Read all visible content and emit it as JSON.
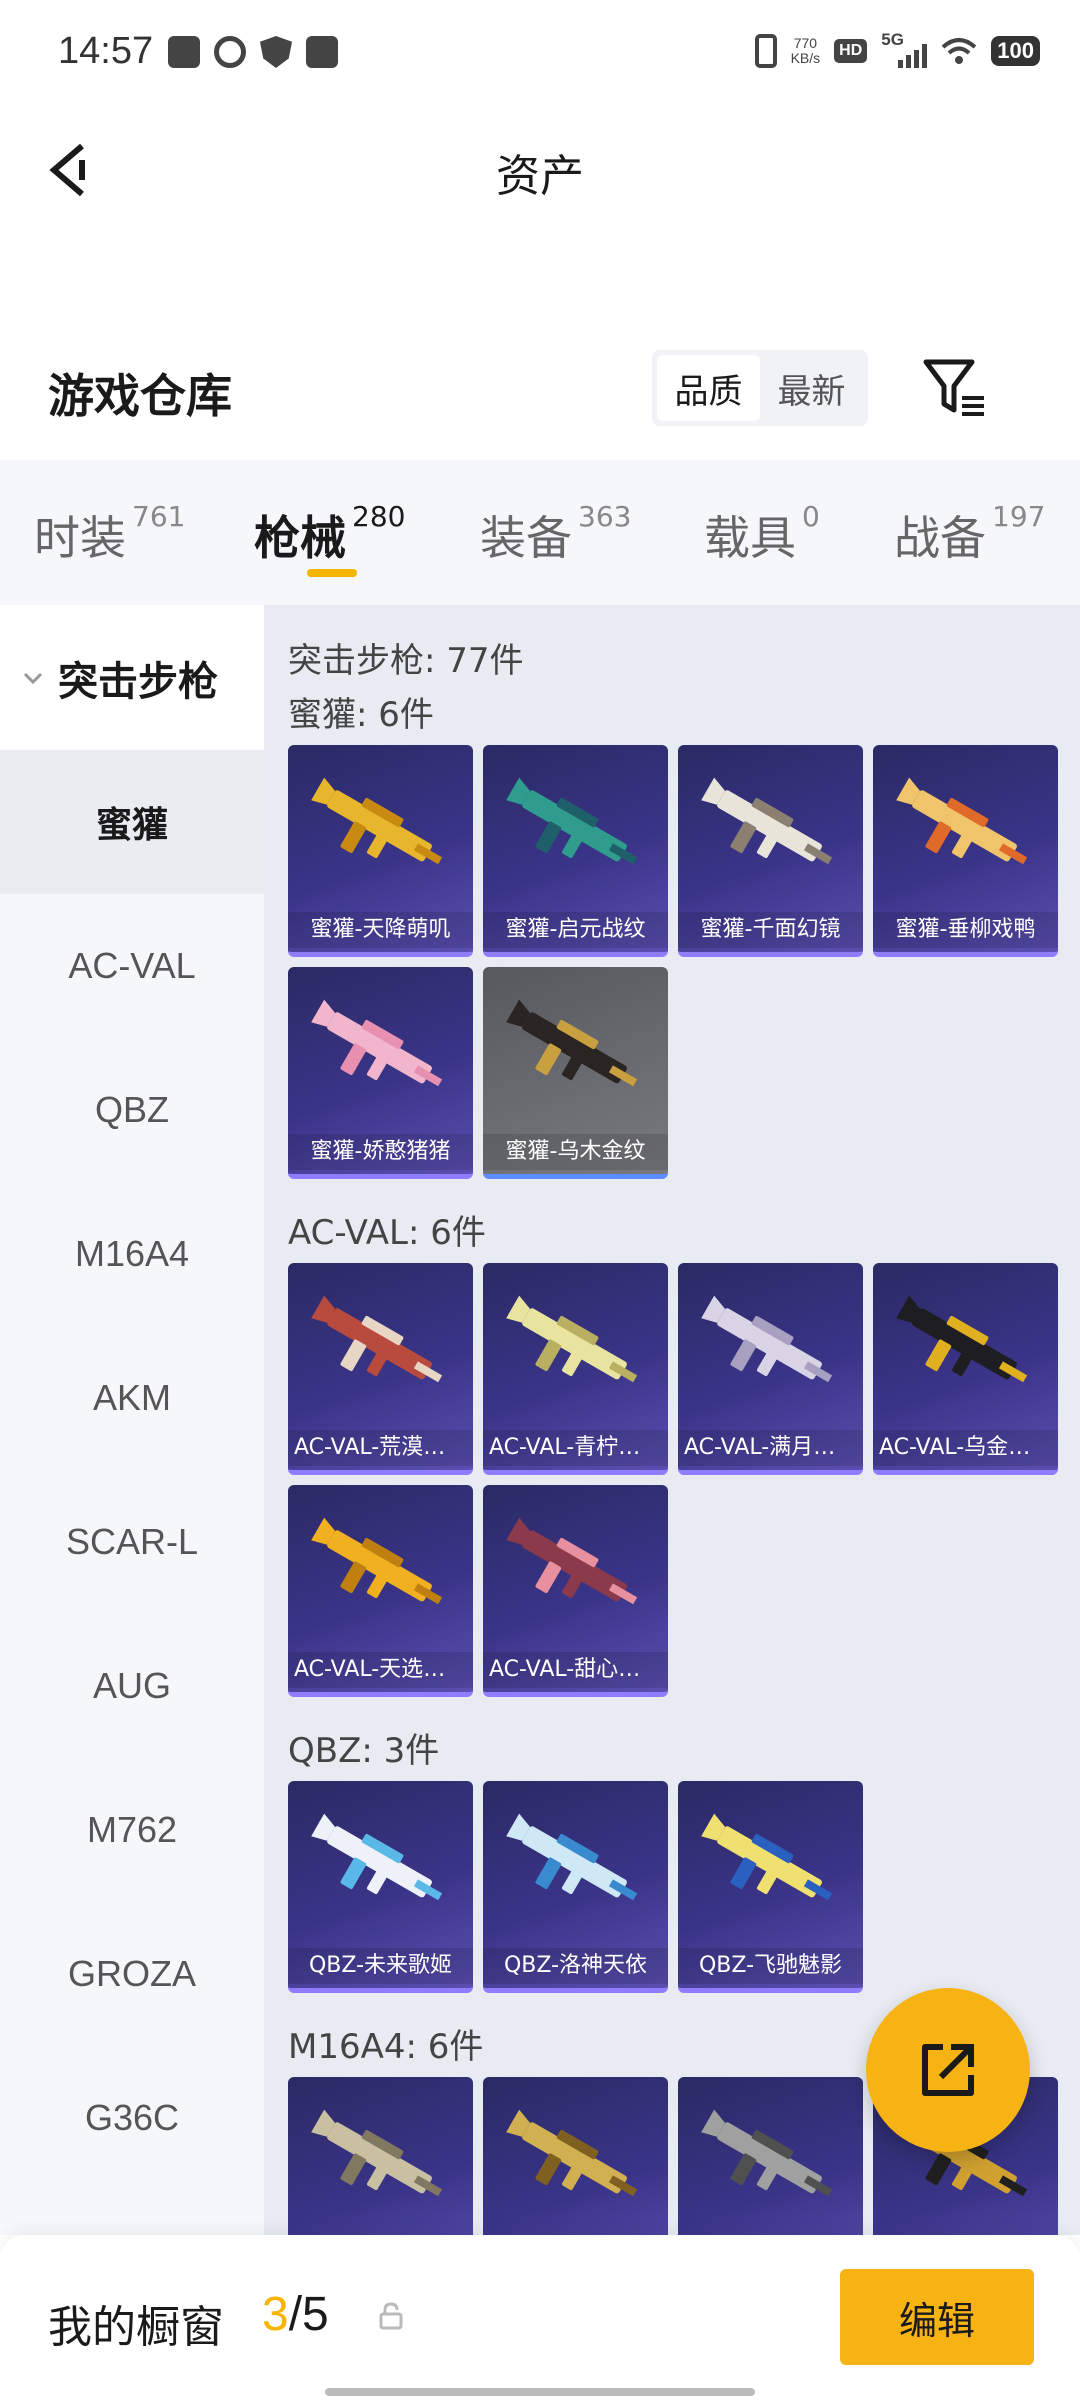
{
  "status_bar": {
    "time": "14:57",
    "net_speed_value": "770",
    "net_speed_unit": "KB/s",
    "hd": "HD",
    "network": "5G",
    "battery": "100"
  },
  "header": {
    "title": "资产"
  },
  "warehouse": {
    "title": "游戏仓库",
    "sort_options": [
      "品质",
      "最新"
    ],
    "sort_selected": "品质"
  },
  "category_tabs": [
    {
      "label": "时装",
      "count": "761"
    },
    {
      "label": "枪械",
      "count": "280"
    },
    {
      "label": "装备",
      "count": "363"
    },
    {
      "label": "载具",
      "count": "0"
    },
    {
      "label": "战备",
      "count": "197"
    }
  ],
  "active_tab": "枪械",
  "sidebar": {
    "header": "突击步枪",
    "items": [
      "蜜獾",
      "AC-VAL",
      "QBZ",
      "M16A4",
      "AKM",
      "SCAR-L",
      "AUG",
      "M762",
      "GROZA",
      "G36C"
    ],
    "active_item": "蜜獾"
  },
  "content": {
    "total": "突击步枪: 77件",
    "groups": [
      {
        "title": "蜜獾: 6件",
        "items": [
          {
            "name": "蜜獾-天降萌叽",
            "color": "#e8b62c",
            "accent": "#c98a12"
          },
          {
            "name": "蜜獾-启元战纹",
            "color": "#2f9c8e",
            "accent": "#1f5f6a"
          },
          {
            "name": "蜜獾-千面幻镜",
            "color": "#e9e4da",
            "accent": "#8a7f70"
          },
          {
            "name": "蜜獾-垂柳戏鸭",
            "color": "#f0c46a",
            "accent": "#e06a2a"
          },
          {
            "name": "蜜獾-娇憨猪猪",
            "color": "#f2b6cc",
            "accent": "#e890b0"
          },
          {
            "name": "蜜獾-乌木金纹",
            "color": "#2a2522",
            "accent": "#c9a040",
            "gray": true
          }
        ]
      },
      {
        "title": "AC-VAL: 6件",
        "items": [
          {
            "name": "AC-VAL-荒漠飞鹰",
            "color": "#b84a3e",
            "accent": "#e8d6c4"
          },
          {
            "name": "AC-VAL-青柠微光",
            "color": "#e8e4a0",
            "accent": "#b8b060"
          },
          {
            "name": "AC-VAL-满月银辉",
            "color": "#d8d4e6",
            "accent": "#a8a0c0"
          },
          {
            "name": "AC-VAL-乌金暗影",
            "color": "#1e1e22",
            "accent": "#e0b020"
          },
          {
            "name": "AC-VAL-天选黄金",
            "color": "#f0b020",
            "accent": "#c08010"
          },
          {
            "name": "AC-VAL-甜心魔术",
            "color": "#8a3a4a",
            "accent": "#e890a0"
          }
        ]
      },
      {
        "title": "QBZ: 3件",
        "items": [
          {
            "name": "QBZ-未来歌姬",
            "color": "#eef2f8",
            "accent": "#5ab8e8"
          },
          {
            "name": "QBZ-洛神天依",
            "color": "#cfe8f6",
            "accent": "#3a8ad0"
          },
          {
            "name": "QBZ-飞驰魅影",
            "color": "#f0e070",
            "accent": "#2a60c0"
          }
        ]
      },
      {
        "title": "M16A4: 6件",
        "items": [
          {
            "name": "",
            "color": "#c8c0a0",
            "accent": "#807860"
          },
          {
            "name": "",
            "color": "#d0b050",
            "accent": "#806020"
          },
          {
            "name": "",
            "color": "#a0a0a0",
            "accent": "#505050"
          },
          {
            "name": "",
            "color": "#d0a030",
            "accent": "#202020"
          }
        ]
      }
    ]
  },
  "bottom_bar": {
    "label": "我的橱窗",
    "current": "3",
    "separator": "/",
    "total": "5",
    "edit_label": "编辑"
  },
  "colors": {
    "accent": "#f7b214",
    "tab_underline": "#f5b400",
    "card_bg": "#3a3488",
    "card_border": "#8f7cff"
  }
}
